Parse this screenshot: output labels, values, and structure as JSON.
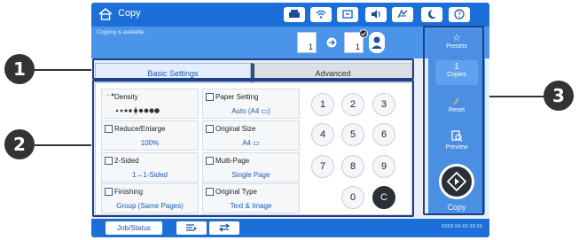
{
  "app": {
    "title": "Copy"
  },
  "status": {
    "message": "Copying is available.",
    "original_pages": "1",
    "output_pages": "1"
  },
  "tabs": {
    "basic": "Basic Settings",
    "advanced": "Advanced"
  },
  "settings": {
    "density": {
      "label": "Density"
    },
    "paper": {
      "label": "Paper Setting",
      "value": "Auto (A4 ▭)"
    },
    "reduce": {
      "label": "Reduce/Enlarge",
      "value": "100%"
    },
    "original_size": {
      "label": "Original Size",
      "value": "A4 ▭"
    },
    "two_sided": {
      "label": "2-Sided",
      "value": "1→1-Sided"
    },
    "multi_page": {
      "label": "Multi-Page",
      "value": "Single Page"
    },
    "finishing": {
      "label": "Finishing",
      "value": "Group (Same Pages)"
    },
    "original_type": {
      "label": "Original Type",
      "value": "Text & Image"
    }
  },
  "keypad": {
    "keys": [
      "1",
      "2",
      "3",
      "4",
      "5",
      "6",
      "7",
      "8",
      "9",
      "0",
      "C"
    ]
  },
  "sidebar": {
    "presets": "Presets",
    "copies_value": "1",
    "copies_label": "Copies",
    "reset": "Reset",
    "preview": "Preview",
    "copy": "Copy"
  },
  "bottombar": {
    "job_status": "Job/Status",
    "datetime": "XXXX-XX-XX XX:XX"
  },
  "callouts": {
    "one": "1",
    "two": "2",
    "three": "3"
  },
  "colors": {
    "titlebar": "#1c6fd8",
    "sidebar": "#4a8fe2",
    "frame": "#1d3f88"
  }
}
